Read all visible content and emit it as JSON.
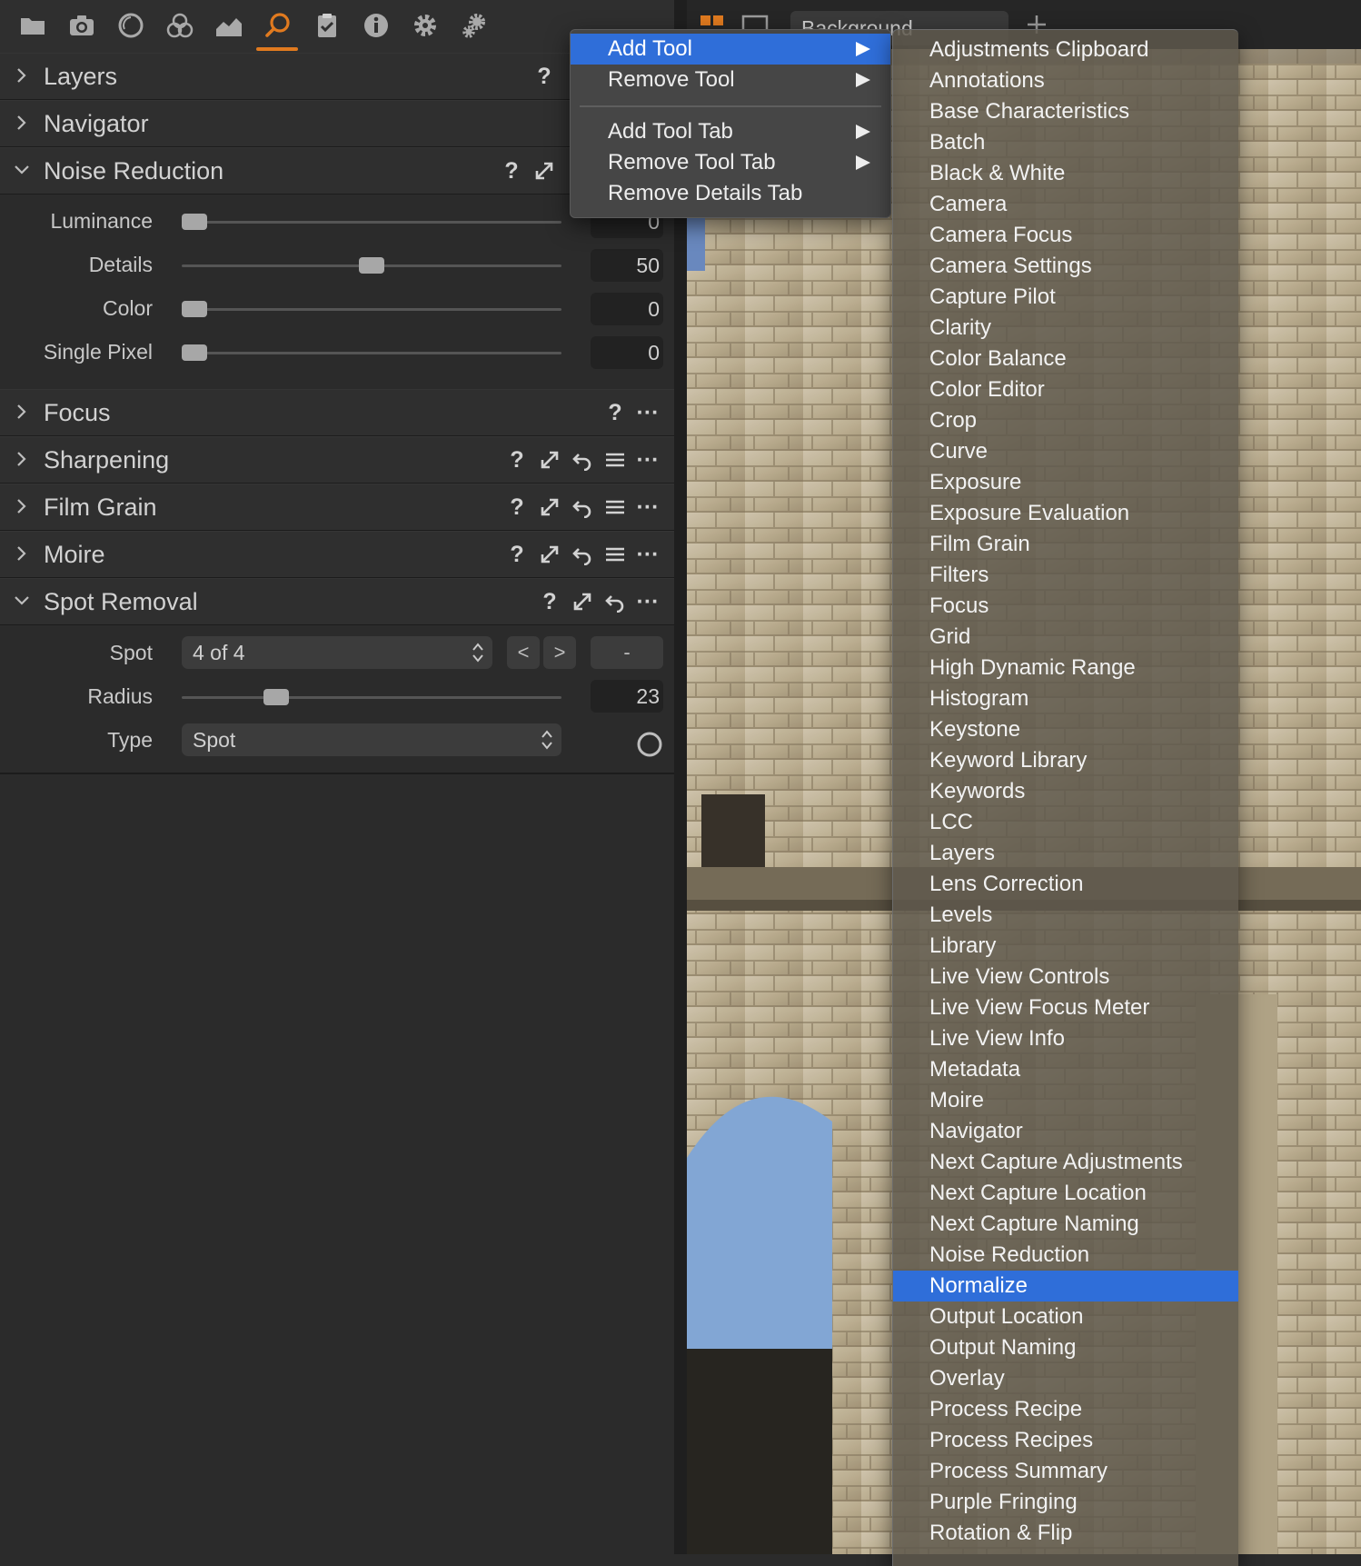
{
  "tab_bar": {
    "icons": [
      "folder-icon",
      "camera-icon",
      "circle-icon",
      "color-circles-icon",
      "histogram-icon",
      "search-icon",
      "clipboard-check-icon",
      "info-icon",
      "gear-icon",
      "gears-icon"
    ],
    "active_index": 5,
    "accent": "#e07a1f"
  },
  "sections": {
    "layers": {
      "title": "Layers"
    },
    "navigator": {
      "title": "Navigator"
    },
    "noise_reduction": {
      "title": "Noise Reduction",
      "rows": [
        {
          "label": "Luminance",
          "value": "0",
          "level": 0
        },
        {
          "label": "Details",
          "value": "50",
          "level": 50
        },
        {
          "label": "Color",
          "value": "0",
          "level": 0
        },
        {
          "label": "Single Pixel",
          "value": "0",
          "level": 0
        }
      ]
    },
    "focus": {
      "title": "Focus"
    },
    "sharpening": {
      "title": "Sharpening"
    },
    "film_grain": {
      "title": "Film Grain"
    },
    "moire": {
      "title": "Moire"
    },
    "spot_removal": {
      "title": "Spot Removal",
      "spot_label": "Spot",
      "spot_value": "4 of 4",
      "prev_label": "<",
      "next_label": ">",
      "minus_label": "-",
      "radius_label": "Radius",
      "radius_value": "23",
      "radius_level": 23,
      "type_label": "Type",
      "type_value": "Spot"
    }
  },
  "help_glyph": "?",
  "more_glyph": "···",
  "viewer": {
    "variant_label": "Background"
  },
  "menu_main": {
    "items": [
      "Add Tool",
      "Remove Tool",
      "Add Tool Tab",
      "Remove Tool Tab",
      "Remove Details Tab"
    ],
    "highlight_color": "#2f6ed9"
  },
  "menu_sub": {
    "items": [
      "Adjustments Clipboard",
      "Annotations",
      "Base Characteristics",
      "Batch",
      "Black & White",
      "Camera",
      "Camera Focus",
      "Camera Settings",
      "Capture Pilot",
      "Clarity",
      "Color Balance",
      "Color Editor",
      "Crop",
      "Curve",
      "Exposure",
      "Exposure Evaluation",
      "Film Grain",
      "Filters",
      "Focus",
      "Grid",
      "High Dynamic Range",
      "Histogram",
      "Keystone",
      "Keyword Library",
      "Keywords",
      "LCC",
      "Layers",
      "Lens Correction",
      "Levels",
      "Library",
      "Live View Controls",
      "Live View Focus Meter",
      "Live View Info",
      "Metadata",
      "Moire",
      "Navigator",
      "Next Capture Adjustments",
      "Next Capture Location",
      "Next Capture Naming",
      "Noise Reduction",
      "Normalize",
      "Output Location",
      "Output Naming",
      "Overlay",
      "Process Recipe",
      "Process Recipes",
      "Process Summary",
      "Purple Fringing",
      "Rotation & Flip"
    ],
    "highlighted": "Normalize"
  }
}
